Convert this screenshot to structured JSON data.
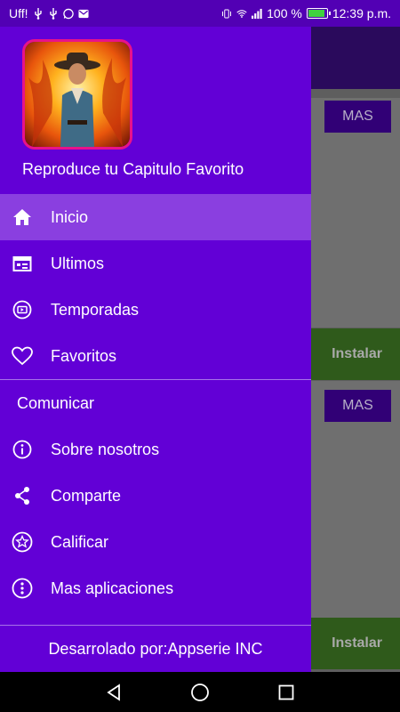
{
  "status_bar": {
    "carrier": "Uff!",
    "battery_percent": "100 %",
    "battery_level": 1.0,
    "time": "12:39 p.m."
  },
  "background_app": {
    "more_button_1": "MAS",
    "install_banner_1": "Instalar",
    "more_button_2": "MAS",
    "install_banner_2": "Instalar"
  },
  "drawer": {
    "header_title": "Reproduce tu Capitulo Favorito",
    "avatar_icon": "cowboy-fire-artwork",
    "main_items": [
      {
        "label": "Inicio",
        "icon": "home-icon",
        "active": true
      },
      {
        "label": "Ultimos",
        "icon": "calendar-icon",
        "active": false
      },
      {
        "label": "Temporadas",
        "icon": "video-icon",
        "active": false
      },
      {
        "label": "Favoritos",
        "icon": "heart-icon",
        "active": false
      }
    ],
    "section_title": "Comunicar",
    "section_items": [
      {
        "label": "Sobre nosotros",
        "icon": "info-icon"
      },
      {
        "label": "Comparte",
        "icon": "share-icon"
      },
      {
        "label": "Calificar",
        "icon": "star-icon"
      },
      {
        "label": "Mas aplicaciones",
        "icon": "more-vertical-icon"
      }
    ],
    "footer": "Desarrolado por:Appserie INC"
  },
  "colors": {
    "drawer_bg": "#6200d6",
    "active_item_bg": "#8a3fe0",
    "avatar_border": "#e8128a"
  }
}
